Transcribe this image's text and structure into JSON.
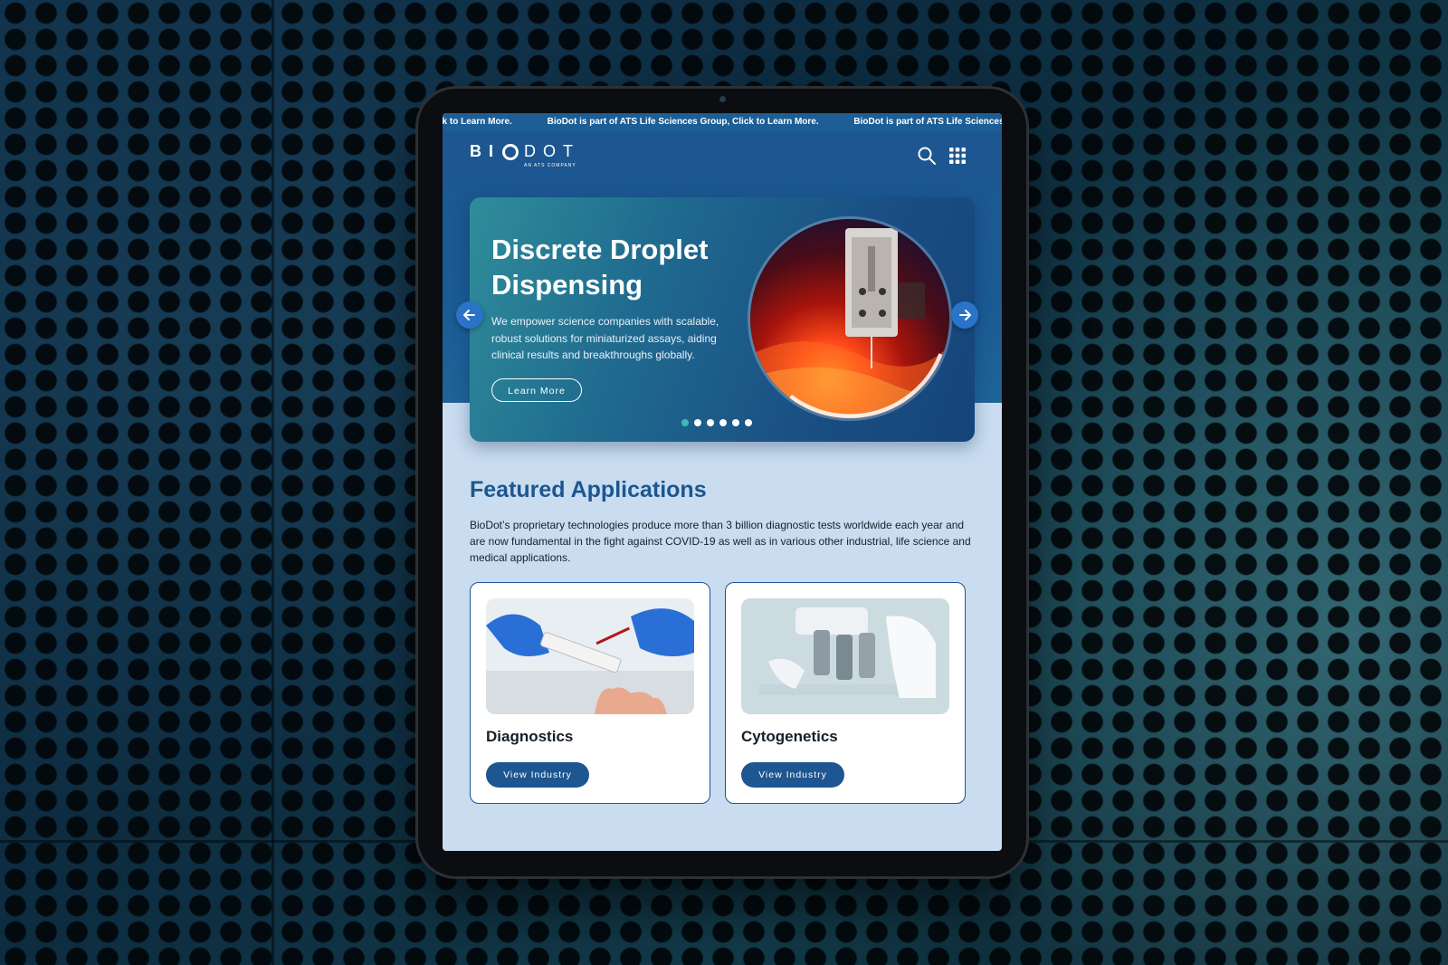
{
  "ticker": {
    "items": [
      "ck to Learn More.",
      "BioDot is part of ATS Life Sciences Group, Click to Learn More.",
      "BioDot is part of ATS Life Sciences"
    ]
  },
  "brand": {
    "logo_left": "BI",
    "logo_right": "DOT",
    "logo_sub": "AN ATS COMPANY"
  },
  "hero": {
    "title": "Discrete Droplet Dispensing",
    "description": "We empower science companies with scalable, robust solutions for miniaturized assays, aiding clinical results and breakthroughs globally.",
    "button_label": "Learn More",
    "slide_count": 6,
    "active_slide": 0
  },
  "featured": {
    "title": "Featured Applications",
    "description": "BioDot’s proprietary technologies produce more than 3 billion diagnostic tests worldwide each year and are now fundamental in the fight against COVID-19 as well as in various other industrial, life science and medical applications.",
    "cards": [
      {
        "title": "Diagnostics",
        "button_label": "View Industry"
      },
      {
        "title": "Cytogenetics",
        "button_label": "View Industry"
      }
    ]
  },
  "icons": {
    "search": "search-icon",
    "menu": "app-grid-icon",
    "prev": "arrow-left-icon",
    "next": "arrow-right-icon"
  },
  "colors": {
    "brand_blue": "#1d5690",
    "accent_teal": "#3fb8c0",
    "page_bg": "#c9dcf0"
  }
}
